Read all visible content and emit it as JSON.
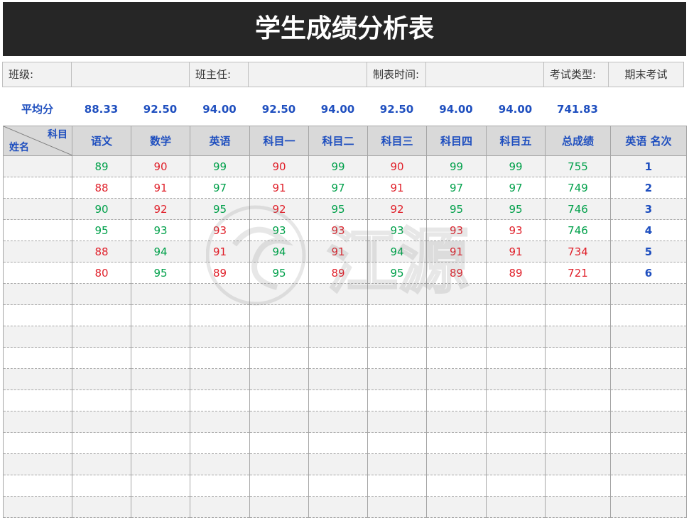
{
  "title": "学生成绩分析表",
  "info": {
    "class_label": "班级:",
    "class_value": "",
    "teacher_label": "班主任:",
    "teacher_value": "",
    "date_label": "制表时间:",
    "date_value": "",
    "exam_label": "考试类型:",
    "exam_value": "期末考试"
  },
  "averages": {
    "label": "平均分",
    "values": [
      "88.33",
      "92.50",
      "94.00",
      "92.50",
      "94.00",
      "92.50",
      "94.00",
      "94.00",
      "741.83"
    ]
  },
  "table": {
    "corner_subject": "科目",
    "corner_name": "姓名",
    "headers": [
      "语文",
      "数学",
      "英语",
      "科目一",
      "科目二",
      "科目三",
      "科目四",
      "科目五",
      "总成绩",
      "英语 名次"
    ],
    "rows": [
      {
        "name": "",
        "scores": [
          "89",
          "90",
          "99",
          "90",
          "99",
          "90",
          "99",
          "99"
        ],
        "total": "755",
        "rank": "1"
      },
      {
        "name": "",
        "scores": [
          "88",
          "91",
          "97",
          "91",
          "97",
          "91",
          "97",
          "97"
        ],
        "total": "749",
        "rank": "2"
      },
      {
        "name": "",
        "scores": [
          "90",
          "92",
          "95",
          "92",
          "95",
          "92",
          "95",
          "95"
        ],
        "total": "746",
        "rank": "3"
      },
      {
        "name": "",
        "scores": [
          "95",
          "93",
          "93",
          "93",
          "93",
          "93",
          "93",
          "93"
        ],
        "total": "746",
        "rank": "4"
      },
      {
        "name": "",
        "scores": [
          "88",
          "94",
          "91",
          "94",
          "91",
          "94",
          "91",
          "91"
        ],
        "total": "734",
        "rank": "5"
      },
      {
        "name": "",
        "scores": [
          "80",
          "95",
          "89",
          "95",
          "89",
          "95",
          "89",
          "89"
        ],
        "total": "721",
        "rank": "6"
      }
    ],
    "empty_row_count": 11
  },
  "colors": {
    "above_average": "#00a04a",
    "below_average": "#e0202a",
    "header_text": "#1f4fbf",
    "title_bg": "#262626"
  },
  "watermark_text": "江源"
}
